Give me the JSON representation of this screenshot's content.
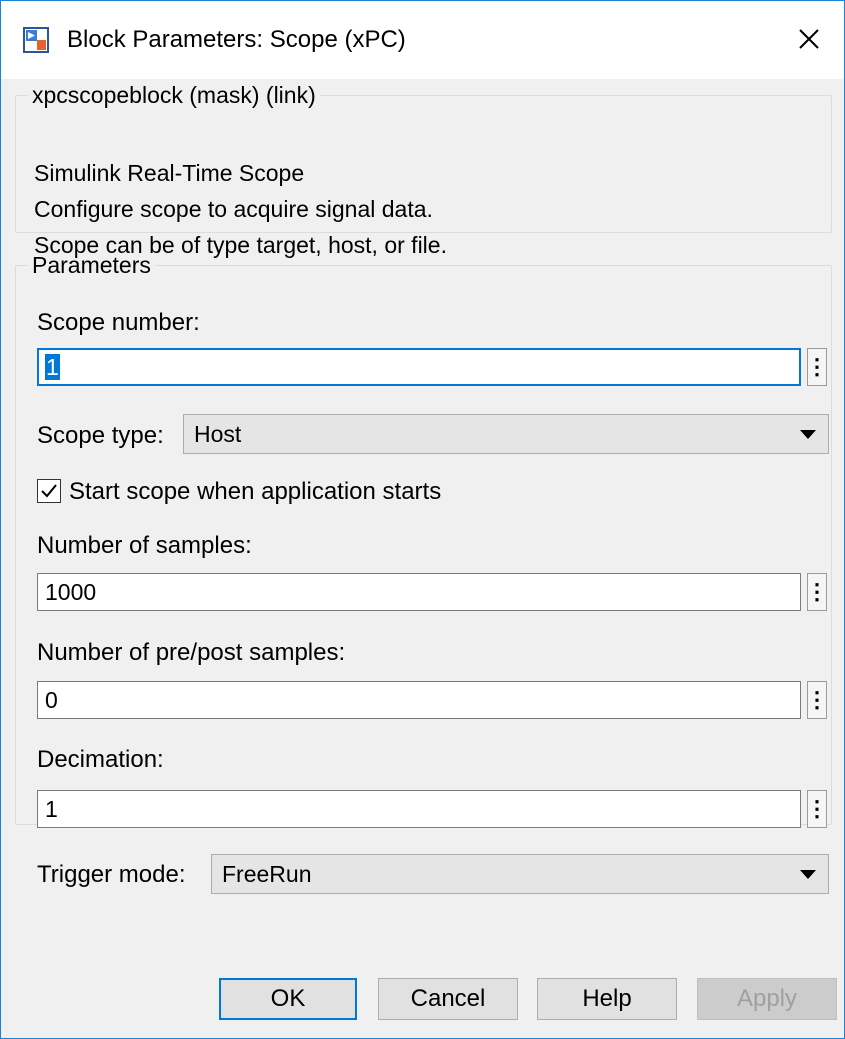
{
  "window": {
    "title": "Block Parameters: Scope (xPC)",
    "icon": "simulink-block-icon",
    "close_icon": "close-icon"
  },
  "mask_group": {
    "legend": "xpcscopeblock (mask) (link)",
    "description_lines": [
      "Simulink Real-Time Scope",
      "Configure scope to acquire signal data.",
      "Scope can be of type target, host, or file."
    ]
  },
  "parameters": {
    "legend": "Parameters",
    "scope_number": {
      "label": "Scope number:",
      "value": "1"
    },
    "scope_type": {
      "label": "Scope type:",
      "value": "Host"
    },
    "start_scope": {
      "label": "Start scope when application starts",
      "checked": true
    },
    "num_samples": {
      "label": "Number of samples:",
      "value": "1000"
    },
    "num_pre_post": {
      "label": "Number of pre/post samples:",
      "value": "0"
    },
    "decimation": {
      "label": "Decimation:",
      "value": "1"
    },
    "trigger_mode": {
      "label": "Trigger mode:",
      "value": "FreeRun"
    }
  },
  "buttons": {
    "ok": "OK",
    "cancel": "Cancel",
    "help": "Help",
    "apply": "Apply"
  },
  "colors": {
    "accent": "#0078d7",
    "window_border": "#1883d7",
    "dialog_background": "#f0f0f0"
  }
}
